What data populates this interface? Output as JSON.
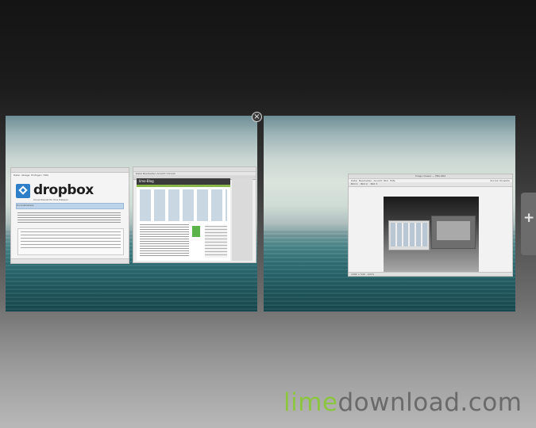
{
  "workspaces": [
    {
      "id": "workspace-1",
      "close_glyph": "×"
    },
    {
      "id": "workspace-2"
    }
  ],
  "add_workspace_glyph": "+",
  "dropbox_window": {
    "menu": [
      "Datei",
      "Ablage",
      "Einfügen",
      "Hilfe"
    ],
    "logo_text": "dropbox",
    "tagline": "Cloud-Dienst für Ihre Dateien",
    "section": "Produktdetails"
  },
  "browser_window": {
    "site": "lime·Blog",
    "menu": [
      "Datei",
      "Bearbeiten",
      "Ansicht",
      "Chronik",
      "Lesezeichen",
      "Extras",
      "Hilfe"
    ]
  },
  "image_viewer_window": {
    "title": "Image Viewer — PNG-Bild",
    "menu": [
      "Datei",
      "Bearbeiten",
      "Ansicht",
      "Bild",
      "Hilfe"
    ],
    "tabs": [
      "Bild 1",
      "Bild 2",
      "Bild 3"
    ],
    "status": "1082 × 540 · 100%",
    "right_buttons": [
      "Zurück",
      "Vorwärts"
    ]
  },
  "watermark": {
    "lime": "lime",
    "rest": "download.com"
  }
}
